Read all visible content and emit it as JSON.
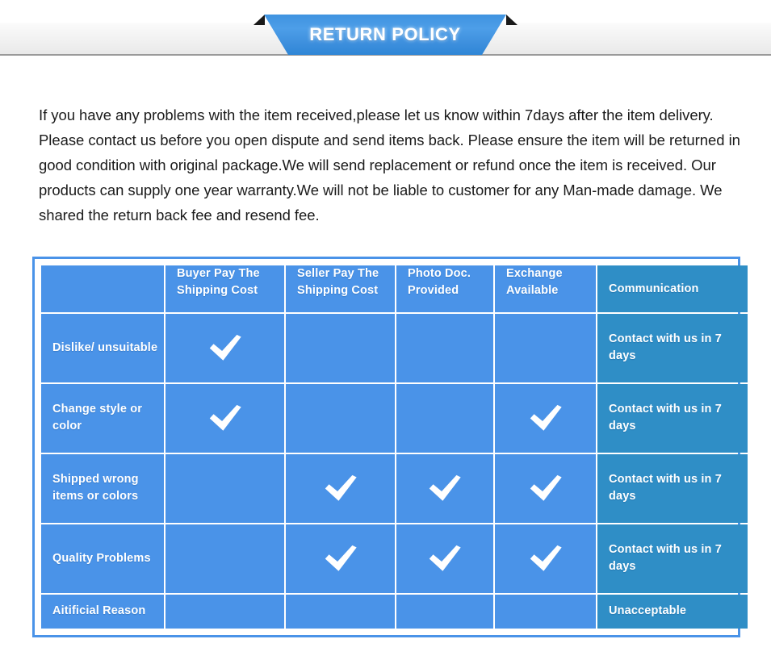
{
  "banner": {
    "title": "RETURN POLICY"
  },
  "policy": {
    "paragraph": "If you have any problems with the item received,please let us know within 7days after the item delivery. Please contact us before you open dispute and send items back. Please ensure the item will be returned in good condition with original package.We will send replacement or refund once the item is received. Our products can supply one year warranty.We will not be liable to customer for any Man-made damage. We shared the return back fee and resend fee."
  },
  "table": {
    "headers": [
      "",
      "Buyer Pay The Shipping Cost",
      "Seller Pay The Shipping Cost",
      "Photo Doc. Provided",
      "Exchange Available",
      "Communication"
    ],
    "rows": [
      {
        "reason": "Dislike/ unsuitable",
        "buyer_pay": true,
        "seller_pay": false,
        "photo_doc": false,
        "exchange": false,
        "communication": "Contact with us in 7 days"
      },
      {
        "reason": "Change style or color",
        "buyer_pay": true,
        "seller_pay": false,
        "photo_doc": false,
        "exchange": true,
        "communication": "Contact with us in 7 days"
      },
      {
        "reason": "Shipped wrong items or colors",
        "buyer_pay": false,
        "seller_pay": true,
        "photo_doc": true,
        "exchange": true,
        "communication": "Contact with us in 7 days"
      },
      {
        "reason": "Quality Problems",
        "buyer_pay": false,
        "seller_pay": true,
        "photo_doc": true,
        "exchange": true,
        "communication": "Contact with us in 7 days"
      },
      {
        "reason": "Aitificial Reason",
        "buyer_pay": false,
        "seller_pay": false,
        "photo_doc": false,
        "exchange": false,
        "communication": "Unacceptable"
      }
    ]
  },
  "colors": {
    "cell_blue": "#4a93e8",
    "communication_blue": "#2f8ec6",
    "ribbon_blue": "#3f93e0",
    "frame_border": "#4a93e8",
    "text_dark": "#1b1b1b"
  },
  "icons": {
    "check": "check-icon"
  }
}
